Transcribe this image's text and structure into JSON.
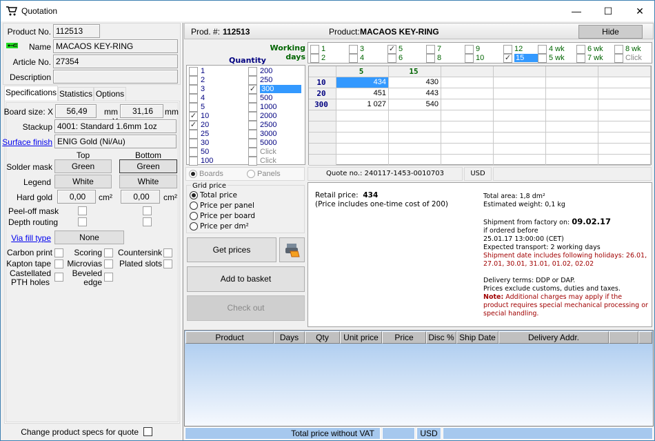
{
  "window": {
    "title": "Quotation",
    "minimize": "—",
    "maximize": "☐",
    "close": "✕"
  },
  "product": {
    "product_no_label": "Product No.",
    "product_no": "112513",
    "name_label": "Name",
    "name": "MACAOS KEY-RING",
    "article_no_label": "Article No.",
    "article_no": "27354",
    "description_label": "Description",
    "description": ""
  },
  "tabs": [
    {
      "label": "Specifications",
      "active": true
    },
    {
      "label": "Statistics"
    },
    {
      "label": "Options"
    }
  ],
  "specs": {
    "board_size_label": "Board size: X",
    "board_x": "56,49",
    "mm_y_label": "mm Y",
    "board_y": "31,16",
    "mm_label": "mm",
    "stackup_label": "Stackup",
    "stackup": "4001: Standard 1.6mm 1oz",
    "surface_finish_label": "Surface finish",
    "surface_finish": "ENIG Gold (Ni/Au)",
    "top_label": "Top",
    "bottom_label": "Bottom",
    "solder_mask_label": "Solder mask",
    "solder_mask_top": "Green",
    "solder_mask_bottom": "Green",
    "legend_label": "Legend",
    "legend_top": "White",
    "legend_bottom": "White",
    "hard_gold_label": "Hard gold",
    "hard_gold_top": "0,00",
    "hard_gold_bottom": "0,00",
    "cm2_label": "cm²",
    "peel_off_label": "Peel-off mask",
    "depth_routing_label": "Depth routing",
    "via_fill_label": "Via fill type",
    "via_fill": "None",
    "carbon_print_label": "Carbon print",
    "scoring_label": "Scoring",
    "countersink_label": "Countersink",
    "kapton_label": "Kapton tape",
    "microvias_label": "Microvias",
    "plated_slots_label": "Plated slots",
    "castellated_label_1": "Castellated",
    "castellated_label_2": "PTH holes",
    "beveled_label_1": "Beveled",
    "beveled_label_2": "edge",
    "change_specs_label": "Change product specs for quote"
  },
  "header": {
    "prod_label": "Prod. #:",
    "prod_no": "112513",
    "product_label": "Product:",
    "product_name": "MACAOS KEY-RING",
    "hide_button": "Hide"
  },
  "working_days": {
    "label_1": "Working",
    "label_2": "days",
    "items": [
      {
        "label": "1",
        "checked": false
      },
      {
        "label": "2",
        "checked": false
      },
      {
        "label": "3",
        "checked": false
      },
      {
        "label": "4",
        "checked": false
      },
      {
        "label": "5",
        "checked": true
      },
      {
        "label": "6",
        "checked": false
      },
      {
        "label": "7",
        "checked": false
      },
      {
        "label": "8",
        "checked": false
      },
      {
        "label": "9",
        "checked": false
      },
      {
        "label": "10",
        "checked": false
      },
      {
        "label": "12",
        "checked": false
      },
      {
        "label": "15",
        "checked": true,
        "selected": true
      },
      {
        "label": "4 wk",
        "checked": false
      },
      {
        "label": "5 wk",
        "checked": false
      },
      {
        "label": "6 wk",
        "checked": false
      },
      {
        "label": "7 wk",
        "checked": false
      },
      {
        "label": "8 wk",
        "checked": false
      },
      {
        "label": "Click",
        "checked": false,
        "grey": true
      }
    ]
  },
  "quantity": {
    "label": "Quantity",
    "col1": [
      {
        "label": "1",
        "checked": false
      },
      {
        "label": "2",
        "checked": false
      },
      {
        "label": "3",
        "checked": false
      },
      {
        "label": "4",
        "checked": false
      },
      {
        "label": "5",
        "checked": false
      },
      {
        "label": "10",
        "checked": true
      },
      {
        "label": "20",
        "checked": true
      },
      {
        "label": "25",
        "checked": false
      },
      {
        "label": "30",
        "checked": false
      },
      {
        "label": "50",
        "checked": false
      },
      {
        "label": "100",
        "checked": false
      }
    ],
    "col2": [
      {
        "label": "200",
        "checked": false
      },
      {
        "label": "250",
        "checked": false
      },
      {
        "label": "300",
        "checked": true,
        "selected": true
      },
      {
        "label": "500",
        "checked": false
      },
      {
        "label": "1000",
        "checked": false
      },
      {
        "label": "2000",
        "checked": false
      },
      {
        "label": "2500",
        "checked": false
      },
      {
        "label": "3000",
        "checked": false
      },
      {
        "label": "5000",
        "checked": false
      },
      {
        "label": "Click",
        "checked": false,
        "grey": true
      },
      {
        "label": "Click",
        "checked": false,
        "grey": true
      }
    ]
  },
  "price_grid": {
    "columns": [
      "5",
      "15",
      "",
      "",
      "",
      ""
    ],
    "rows": [
      {
        "qty": "10",
        "values": [
          "434",
          "430"
        ]
      },
      {
        "qty": "20",
        "values": [
          "451",
          "443"
        ]
      },
      {
        "qty": "300",
        "values": [
          "1 027",
          "540"
        ]
      },
      {
        "qty": "",
        "values": []
      },
      {
        "qty": "",
        "values": []
      },
      {
        "qty": "",
        "values": []
      },
      {
        "qty": "",
        "values": []
      },
      {
        "qty": "",
        "values": []
      }
    ]
  },
  "boards_panels": {
    "boards": "Boards",
    "panels": "Panels"
  },
  "quote": {
    "quote_no": "Quote no.: 240117-1453-0010703",
    "currency": "USD"
  },
  "grid_price": {
    "title": "Grid price",
    "options": [
      {
        "label": "Total price",
        "selected": true
      },
      {
        "label": "Price per panel"
      },
      {
        "label": "Price per board"
      },
      {
        "label": "Price per dm²"
      }
    ]
  },
  "actions": {
    "get_prices": "Get prices",
    "add_to_basket": "Add to basket",
    "check_out": "Check out"
  },
  "details": {
    "retail_label": "Retail price:",
    "retail_value": "434",
    "one_time": "(Price includes one-time cost of 200)",
    "total_area": "Total area: 1,8 dm²",
    "weight": "Estimated weight: 0,1 kg",
    "shipment_label": "Shipment from factory on:",
    "shipment_date": "09.02.17",
    "if_ordered": "if ordered before",
    "order_deadline": "25.01.17 13:00:00  (CET)",
    "transport": "Expected transport: 2 working days",
    "holidays": "Shipment date includes following holidays: 26.01, 27.01, 30.01, 31.01, 01.02, 02.02",
    "delivery_terms": "Delivery terms: DDP or DAP.",
    "prices_exclude": "Prices exclude customs, duties and taxes.",
    "note_label": "Note:",
    "note_text": "Additional charges may apply if the product requires special mechanical processing or special handling."
  },
  "basket": {
    "columns": [
      "Product",
      "Days",
      "Qty",
      "Unit price",
      "Price",
      "Disc %",
      "Ship Date",
      "Delivery Addr.",
      ""
    ],
    "footer_label": "Total price without VAT",
    "footer_total": "",
    "footer_currency": "USD"
  }
}
